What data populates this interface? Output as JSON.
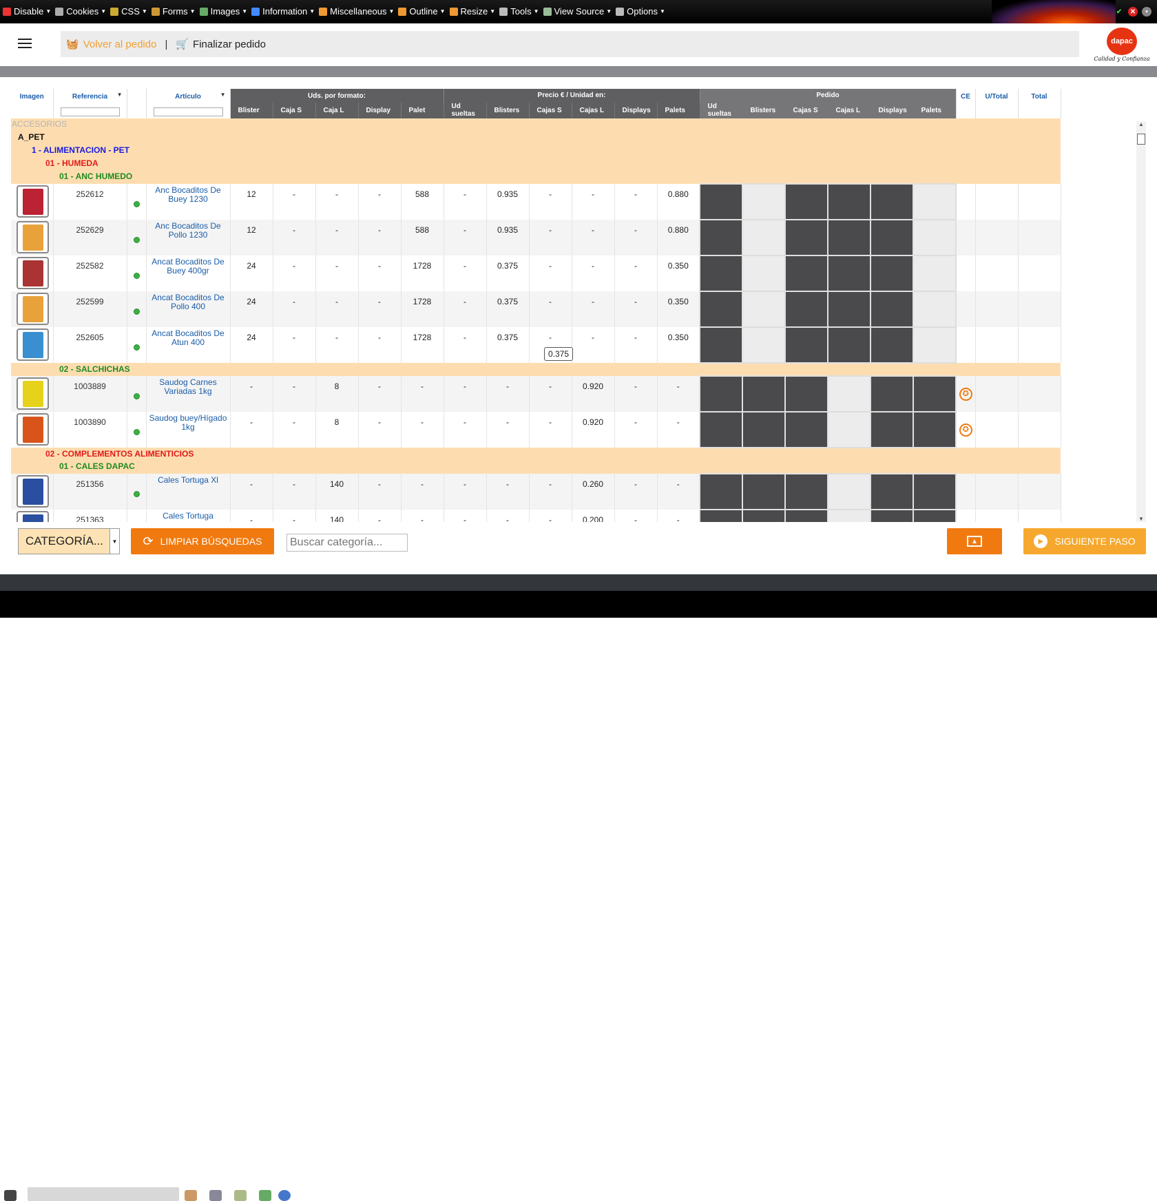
{
  "toolbar": {
    "items": [
      {
        "icon": "disable-icon",
        "label": "Disable",
        "color": "#e33"
      },
      {
        "icon": "cookies-icon",
        "label": "Cookies",
        "color": "#aaa"
      },
      {
        "icon": "css-icon",
        "label": "CSS",
        "color": "#ca3"
      },
      {
        "icon": "forms-icon",
        "label": "Forms",
        "color": "#c93"
      },
      {
        "icon": "images-icon",
        "label": "Images",
        "color": "#6a6"
      },
      {
        "icon": "information-icon",
        "label": "Information",
        "color": "#48f"
      },
      {
        "icon": "miscellaneous-icon",
        "label": "Miscellaneous",
        "color": "#e93"
      },
      {
        "icon": "outline-icon",
        "label": "Outline",
        "color": "#e93"
      },
      {
        "icon": "resize-icon",
        "label": "Resize",
        "color": "#e93"
      },
      {
        "icon": "tools-icon",
        "label": "Tools",
        "color": "#bbb"
      },
      {
        "icon": "view-source-icon",
        "label": "View Source",
        "color": "#9b9"
      },
      {
        "icon": "options-icon",
        "label": "Options",
        "color": "#bbb"
      }
    ]
  },
  "header": {
    "back_label": "Volver al pedido",
    "separator": "|",
    "finish_label": "Finalizar pedido",
    "logo_text": "dapac",
    "logo_tagline": "Calidad y Confianza"
  },
  "table": {
    "col_imagen": "Imagen",
    "col_referencia": "Referencia",
    "col_articulo": "Artículo",
    "grp_uds": "Uds. por formato:",
    "grp_precio": "Precio € / Unidad en:",
    "grp_pedido": "Pedido",
    "uds_cols": [
      "Blister",
      "Caja S",
      "Caja L",
      "Display",
      "Palet"
    ],
    "precio_cols": [
      "Ud sueltas",
      "Blisters",
      "Cajas S",
      "Cajas L",
      "Displays",
      "Palets"
    ],
    "pedido_cols": [
      "Ud sueltas",
      "Blisters",
      "Cajas S",
      "Cajas L",
      "Displays",
      "Palets"
    ],
    "col_ce": "CE",
    "col_utotal": "U/Total",
    "col_total": "Total"
  },
  "rows": [
    {
      "type": "cat",
      "level": "acc",
      "text": "ACCESORIOS"
    },
    {
      "type": "cat",
      "level": "l1",
      "text": "A_PET"
    },
    {
      "type": "cat",
      "level": "l2",
      "text": "1 - ALIMENTACION - PET"
    },
    {
      "type": "cat",
      "level": "l3",
      "text": "01 - HUMEDA"
    },
    {
      "type": "cat",
      "level": "l4",
      "text": "01 - ANC HUMEDO"
    },
    {
      "type": "item",
      "img": "#b23",
      "ref": "252612",
      "art": "Anc Bocaditos De Buey 1230",
      "uds": [
        "12",
        "-",
        "-",
        "-",
        "588"
      ],
      "precio": [
        "-",
        "0.935",
        "-",
        "-",
        "-",
        "0.880"
      ],
      "pedido": [
        "dk",
        "lt",
        "dk",
        "dk",
        "dk",
        "lt"
      ],
      "ce": false
    },
    {
      "type": "item",
      "img": "#e9a23b",
      "ref": "252629",
      "art": "Anc Bocaditos De Pollo 1230",
      "uds": [
        "12",
        "-",
        "-",
        "-",
        "588"
      ],
      "precio": [
        "-",
        "0.935",
        "-",
        "-",
        "-",
        "0.880"
      ],
      "pedido": [
        "dk",
        "lt",
        "dk",
        "dk",
        "dk",
        "lt"
      ],
      "ce": false
    },
    {
      "type": "item",
      "img": "#a33",
      "ref": "252582",
      "art": "Ancat Bocaditos De Buey 400gr",
      "uds": [
        "24",
        "-",
        "-",
        "-",
        "1728"
      ],
      "precio": [
        "-",
        "0.375",
        "-",
        "-",
        "-",
        "0.350"
      ],
      "pedido": [
        "dk",
        "lt",
        "dk",
        "dk",
        "dk",
        "lt"
      ],
      "ce": false
    },
    {
      "type": "item",
      "img": "#e9a23b",
      "ref": "252599",
      "art": "Ancat Bocaditos De Pollo 400",
      "uds": [
        "24",
        "-",
        "-",
        "-",
        "1728"
      ],
      "precio": [
        "-",
        "0.375",
        "-",
        "-",
        "-",
        "0.350"
      ],
      "pedido": [
        "dk",
        "lt",
        "dk",
        "dk",
        "dk",
        "lt"
      ],
      "ce": false
    },
    {
      "type": "item",
      "img": "#3a8fd0",
      "ref": "252605",
      "art": "Ancat Bocaditos De Atun 400",
      "uds": [
        "24",
        "-",
        "-",
        "-",
        "1728"
      ],
      "precio": [
        "-",
        "0.375",
        "-",
        "-",
        "-",
        "0.350"
      ],
      "pedido": [
        "dk",
        "lt",
        "dk",
        "dk",
        "dk",
        "lt"
      ],
      "ce": false
    },
    {
      "type": "cat",
      "level": "l4",
      "text": "02 - SALCHICHAS"
    },
    {
      "type": "item",
      "img": "#e6d21a",
      "ref": "1003889",
      "art": "Saudog Carnes Variadas 1kg",
      "uds": [
        "-",
        "-",
        "8",
        "-",
        "-"
      ],
      "precio": [
        "-",
        "-",
        "-",
        "0.920",
        "-",
        "-"
      ],
      "pedido": [
        "dk",
        "dk",
        "dk",
        "lt",
        "dk",
        "dk"
      ],
      "ce": true
    },
    {
      "type": "item",
      "img": "#d9541a",
      "ref": "1003890",
      "art": "Saudog buey/Hígado 1kg",
      "uds": [
        "-",
        "-",
        "8",
        "-",
        "-"
      ],
      "precio": [
        "-",
        "-",
        "-",
        "0.920",
        "-",
        "-"
      ],
      "pedido": [
        "dk",
        "dk",
        "dk",
        "lt",
        "dk",
        "dk"
      ],
      "ce": true
    },
    {
      "type": "cat",
      "level": "l3",
      "text": "02 - COMPLEMENTOS ALIMENTICIOS"
    },
    {
      "type": "cat",
      "level": "l4",
      "text": "01 - CALES DAPAC"
    },
    {
      "type": "item",
      "img": "#2a4fa0",
      "ref": "251356",
      "art": "Cales Tortuga Xl",
      "uds": [
        "-",
        "-",
        "140",
        "-",
        "-"
      ],
      "precio": [
        "-",
        "-",
        "-",
        "0.260",
        "-",
        "-"
      ],
      "pedido": [
        "dk",
        "dk",
        "dk",
        "lt",
        "dk",
        "dk"
      ],
      "ce": false
    },
    {
      "type": "item",
      "img": "#2a4fa0",
      "ref": "251363",
      "art": "Cales Tortuga",
      "uds": [
        "-",
        "-",
        "140",
        "-",
        "-"
      ],
      "precio": [
        "-",
        "-",
        "-",
        "0.200",
        "-",
        "-"
      ],
      "pedido": [
        "dk",
        "dk",
        "dk",
        "lt",
        "dk",
        "dk"
      ],
      "ce": false
    }
  ],
  "tooltip": "0.375",
  "footer": {
    "category_select": "CATEGORÍA...",
    "clear_button": "LIMPIAR BÚSQUEDAS",
    "search_placeholder": "Buscar categoría...",
    "next_button": "SIGUIENTE PASO"
  },
  "colors": {
    "accent": "#f07a10",
    "next": "#f6a82e",
    "category_band": "#fdddb0",
    "dark_cell": "#4a4a4d"
  }
}
